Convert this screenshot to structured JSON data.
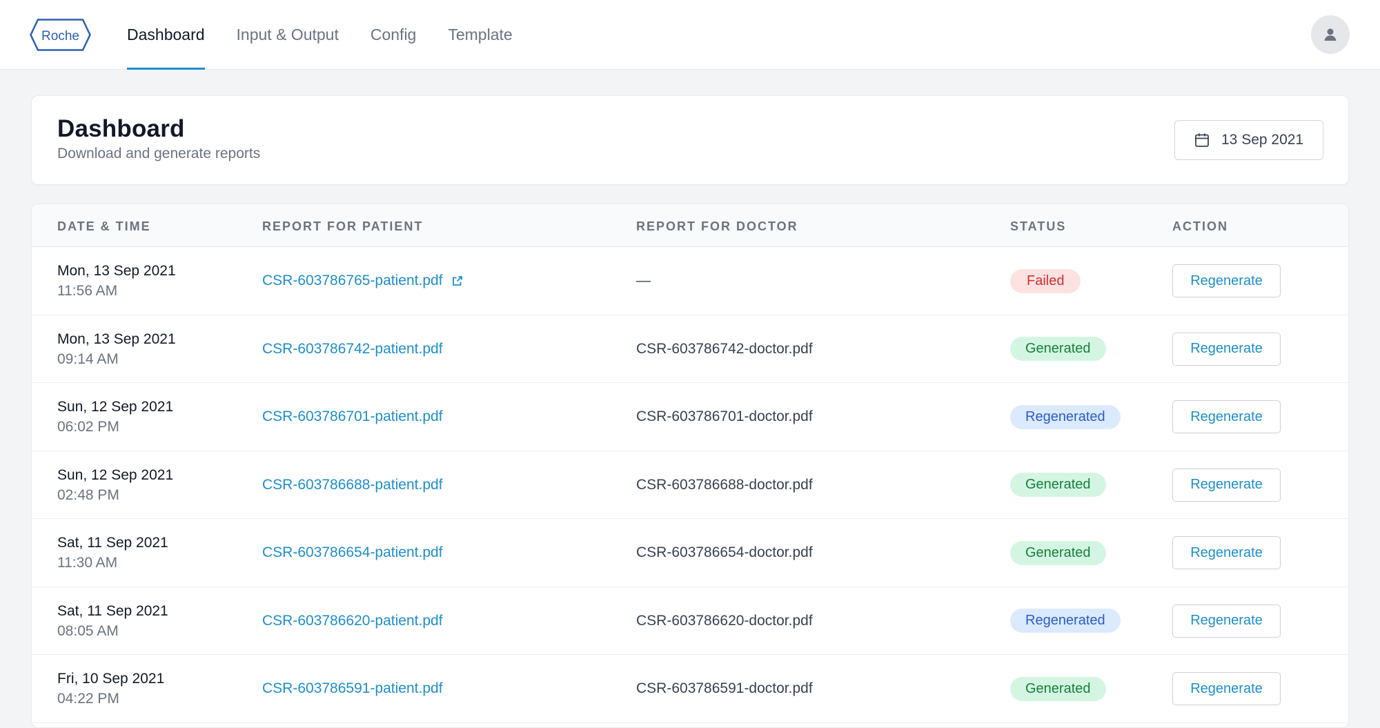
{
  "nav": {
    "logo_text": "Roche",
    "tabs": [
      {
        "label": "Dashboard",
        "active": true
      },
      {
        "label": "Input & Output",
        "active": false
      },
      {
        "label": "Config",
        "active": false
      },
      {
        "label": "Template",
        "active": false
      }
    ]
  },
  "header": {
    "title": "Dashboard",
    "subtitle": "Download and generate reports",
    "date": "13 Sep 2021"
  },
  "table": {
    "columns": [
      "DATE & TIME",
      "REPORT FOR PATIENT",
      "REPORT FOR DOCTOR",
      "STATUS",
      "ACTION"
    ],
    "rows": [
      {
        "date": "Mon, 13 Sep 2021",
        "time": "11:56 AM",
        "patient": "CSR-603786765-patient.pdf",
        "doctor": "—",
        "status": "Failed",
        "action": "Regenerate"
      },
      {
        "date": "Mon, 13 Sep 2021",
        "time": "09:14 AM",
        "patient": "CSR-603786742-patient.pdf",
        "doctor": "CSR-603786742-doctor.pdf",
        "status": "Generated",
        "action": "Regenerate"
      },
      {
        "date": "Sun, 12 Sep 2021",
        "time": "06:02 PM",
        "patient": "CSR-603786701-patient.pdf",
        "doctor": "CSR-603786701-doctor.pdf",
        "status": "Regenerated",
        "action": "Regenerate"
      },
      {
        "date": "Sun, 12 Sep 2021",
        "time": "02:48 PM",
        "patient": "CSR-603786688-patient.pdf",
        "doctor": "CSR-603786688-doctor.pdf",
        "status": "Generated",
        "action": "Regenerate"
      },
      {
        "date": "Sat, 11 Sep 2021",
        "time": "11:30 AM",
        "patient": "CSR-603786654-patient.pdf",
        "doctor": "CSR-603786654-doctor.pdf",
        "status": "Generated",
        "action": "Regenerate"
      },
      {
        "date": "Sat, 11 Sep 2021",
        "time": "08:05 AM",
        "patient": "CSR-603786620-patient.pdf",
        "doctor": "CSR-603786620-doctor.pdf",
        "status": "Regenerated",
        "action": "Regenerate"
      },
      {
        "date": "Fri, 10 Sep 2021",
        "time": "04:22 PM",
        "patient": "CSR-603786591-patient.pdf",
        "doctor": "CSR-603786591-doctor.pdf",
        "status": "Generated",
        "action": "Regenerate"
      }
    ]
  },
  "colors": {
    "accent": "#1d8ecc",
    "brand_logo": "#2b5fb4",
    "failed": "#d22f2f",
    "generated": "#15803d",
    "regenerated": "#2a5bc9"
  },
  "icons": {
    "logo": "roche-hexagon-logo",
    "avatar": "user-icon",
    "date": "calendar-icon",
    "external": "external-link-icon"
  }
}
